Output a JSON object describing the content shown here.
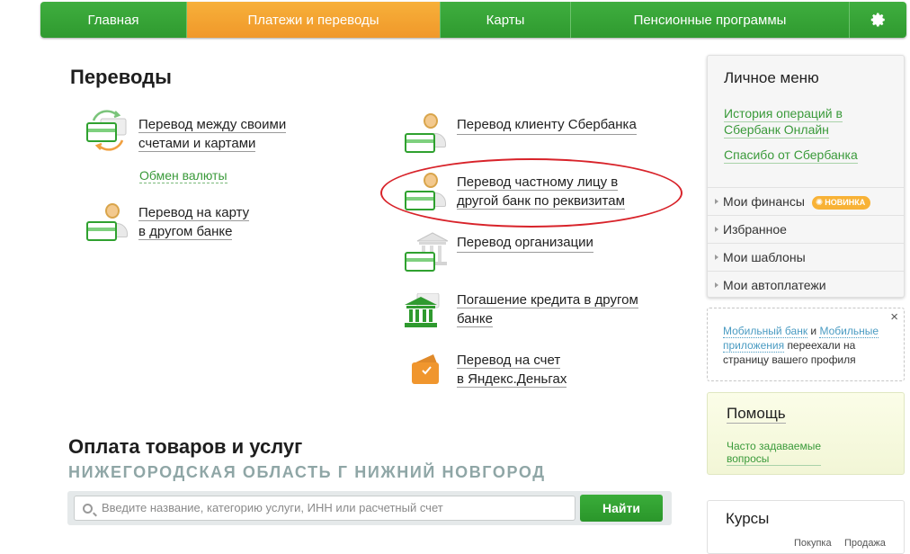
{
  "nav": {
    "items": [
      {
        "label": "Главная"
      },
      {
        "label": "Платежи и переводы"
      },
      {
        "label": "Карты"
      },
      {
        "label": "Пенсионные программы"
      }
    ],
    "settings_icon": "gear-icon"
  },
  "transfers": {
    "title": "Переводы",
    "own_accounts_l1": "Перевод между своими",
    "own_accounts_l2": "счетами и картами",
    "exchange": "Обмен валюты",
    "card_other_bank_l1": "Перевод на карту",
    "card_other_bank_l2": "в другом банке",
    "sber_client": "Перевод клиенту Сбербанка",
    "private_person_l1": "Перевод частному лицу в",
    "private_person_l2": "другой банк по реквизитам",
    "organization": "Перевод организации",
    "loan_l1": "Погашение кредита в другом",
    "loan_l2": "банке",
    "yandex_l1": "Перевод на счет",
    "yandex_l2": "в Яндекс.Деньгах"
  },
  "payments": {
    "title": "Оплата товаров и услуг",
    "region": "НИЖЕГОРОДСКАЯ ОБЛАСТЬ Г НИЖНИЙ НОВГОРОД",
    "search_placeholder": "Введите название, категорию услуги, ИНН или расчетный счет",
    "search_button": "Найти"
  },
  "sidebar": {
    "title": "Личное меню",
    "history_l1": "История операций в",
    "history_l2": "Сбербанк Онлайн",
    "thanks": "Спасибо от Сбербанка",
    "rows": [
      "Мои финансы",
      "Избранное",
      "Мои шаблоны",
      "Мои автоплатежи"
    ],
    "badge": "НОВИНКА",
    "notice": {
      "link1": "Мобильный банк",
      "and": "и",
      "link2": "Мобильные приложения",
      "rest": "переехали на страницу вашего профиля",
      "close": "×"
    },
    "help": {
      "title": "Помощь",
      "faq_l1": "Часто задаваемые",
      "faq_l2": "вопросы"
    },
    "rates": {
      "title": "Курсы",
      "buy": "Покупка",
      "sell": "Продажа"
    }
  },
  "colors": {
    "green": "#2f9a2f",
    "orange": "#f0982a",
    "highlight": "#d8232a",
    "link": "#3a9a3a"
  }
}
